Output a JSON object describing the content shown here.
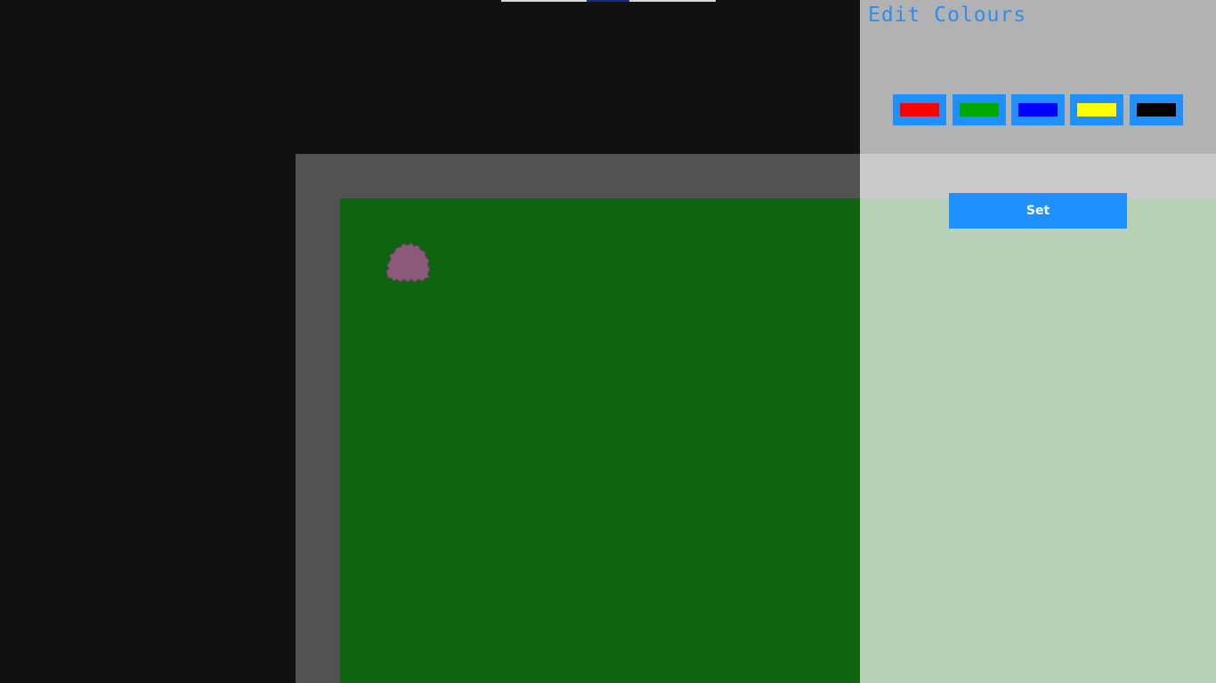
{
  "panel": {
    "title": "Edit Colours",
    "set_label": "Set",
    "swatches": [
      {
        "name": "red",
        "color": "#ff0000"
      },
      {
        "name": "green",
        "color": "#00a800"
      },
      {
        "name": "blue",
        "color": "#0000ff"
      },
      {
        "name": "yellow",
        "color": "#ffff00"
      },
      {
        "name": "black",
        "color": "#000000"
      }
    ],
    "accent_color": "#1e90ff"
  },
  "game": {
    "creature": {
      "name": "creature",
      "color": "#8b5a7a"
    },
    "grass_color": "#0f6410",
    "wall_color": "#525252"
  }
}
